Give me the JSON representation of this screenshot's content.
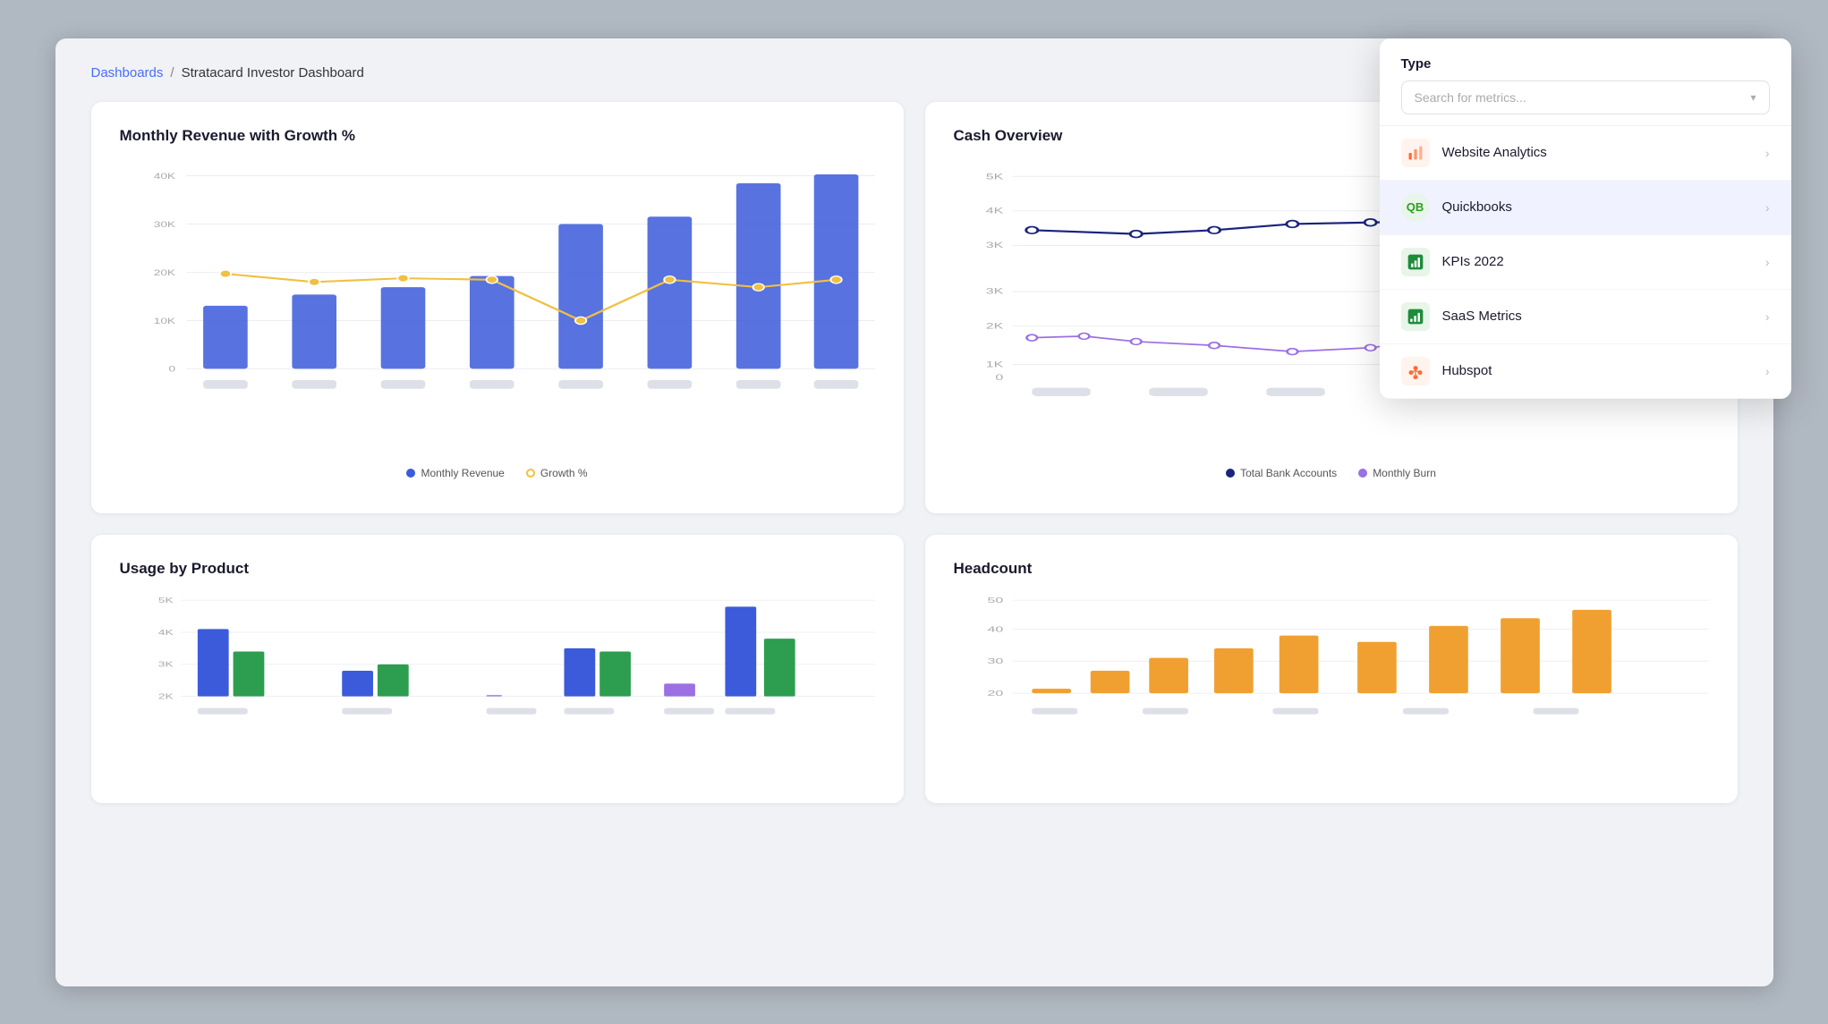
{
  "breadcrumb": {
    "link": "Dashboards",
    "separator": "/",
    "current": "Stratacard Investor Dashboard"
  },
  "charts": {
    "monthly_revenue": {
      "title": "Monthly Revenue with Growth %",
      "y_labels": [
        "40K",
        "30K",
        "20K",
        "10K",
        "0"
      ],
      "legend": {
        "revenue_label": "Monthly Revenue",
        "growth_label": "Growth %"
      },
      "bar_color": "#3b5bdb",
      "line_color": "#f0c040"
    },
    "cash_overview": {
      "title": "Cash Overview",
      "y_labels_top": [
        "5K",
        "4K",
        "3K"
      ],
      "y_labels_bottom": [
        "2K",
        "1K",
        "0"
      ],
      "legend": {
        "bank_label": "Total Bank Accounts",
        "burn_label": "Monthly Burn"
      },
      "bank_color": "#1a237e",
      "burn_color": "#9c6fe4"
    },
    "usage_by_product": {
      "title": "Usage by Product",
      "y_labels": [
        "5K",
        "4K",
        "3K",
        "2K"
      ],
      "bar_colors": [
        "#3b5bdb",
        "#2d9e4f"
      ]
    },
    "headcount": {
      "title": "Headcount",
      "y_labels": [
        "50",
        "40",
        "30",
        "20"
      ],
      "bar_color": "#f0a030"
    }
  },
  "dropdown": {
    "type_label": "Type",
    "search_placeholder": "Search for metrics...",
    "items": [
      {
        "id": "website_analytics",
        "label": "Website Analytics",
        "icon": "📊",
        "icon_color": "#ff6b35",
        "active": false
      },
      {
        "id": "quickbooks",
        "label": "Quickbooks",
        "icon": "QB",
        "icon_color": "#2ca01c",
        "active": true
      },
      {
        "id": "kpis_2022",
        "label": "KPIs 2022",
        "icon": "📈",
        "icon_color": "#1e8c3a",
        "active": false
      },
      {
        "id": "saas_metrics",
        "label": "SaaS Metrics",
        "icon": "📊",
        "icon_color": "#1e8c3a",
        "active": false
      },
      {
        "id": "hubspot",
        "label": "Hubspot",
        "icon": "🔶",
        "icon_color": "#ff6b35",
        "active": false
      }
    ]
  }
}
